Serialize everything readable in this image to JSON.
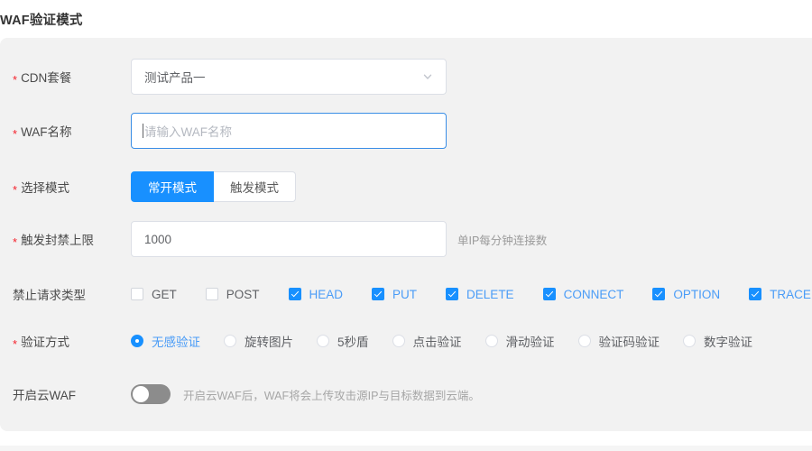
{
  "page": {
    "title": "WAF验证模式"
  },
  "form": {
    "rows": {
      "cdn_package": {
        "label": "CDN套餐",
        "required": true,
        "value": "测试产品一",
        "icon": "chevron-down-icon"
      },
      "waf_name": {
        "label": "WAF名称",
        "required": true,
        "value": "",
        "placeholder": "请输入WAF名称",
        "focused": true
      },
      "mode": {
        "label": "选择模式",
        "required": true,
        "options": [
          {
            "label": "常开模式",
            "active": true
          },
          {
            "label": "触发模式",
            "active": false
          }
        ]
      },
      "ban_threshold": {
        "label": "触发封禁上限",
        "required": true,
        "value": "1000",
        "hint": "单IP每分钟连接数"
      },
      "blocked_methods": {
        "label": "禁止请求类型",
        "required": false,
        "items": [
          {
            "label": "GET",
            "checked": false
          },
          {
            "label": "POST",
            "checked": false
          },
          {
            "label": "HEAD",
            "checked": true
          },
          {
            "label": "PUT",
            "checked": true
          },
          {
            "label": "DELETE",
            "checked": true
          },
          {
            "label": "CONNECT",
            "checked": true
          },
          {
            "label": "OPTION",
            "checked": true
          },
          {
            "label": "TRACE",
            "checked": true
          }
        ]
      },
      "verify_method": {
        "label": "验证方式",
        "required": true,
        "items": [
          {
            "label": "无感验证",
            "selected": true
          },
          {
            "label": "旋转图片",
            "selected": false
          },
          {
            "label": "5秒盾",
            "selected": false
          },
          {
            "label": "点击验证",
            "selected": false
          },
          {
            "label": "滑动验证",
            "selected": false
          },
          {
            "label": "验证码验证",
            "selected": false
          },
          {
            "label": "数字验证",
            "selected": false
          }
        ]
      },
      "cloud_waf": {
        "label": "开启云WAF",
        "required": false,
        "enabled": false,
        "description": "开启云WAF后，WAF将会上传攻击源IP与目标数据到云端。"
      }
    }
  },
  "colors": {
    "accent": "#1890ff",
    "required_mark": "#f5222d",
    "panel_bg": "#f2f2f2",
    "label_text": "#4a4a4a",
    "hint_text": "#9a9a9a"
  }
}
